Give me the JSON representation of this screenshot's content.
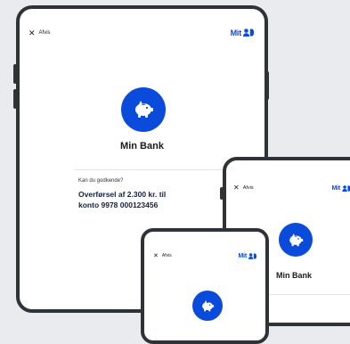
{
  "tablet": {
    "close_label": "Afvis",
    "brand": "Mit",
    "bank_name": "Min Bank",
    "question": "Kan du godkende?",
    "detail_line1": "Overførsel af 2.300 kr. til",
    "detail_line2": "konto 9978 000123456"
  },
  "phone_right": {
    "close_label": "Afvis",
    "brand": "Mit",
    "bank_name": "Min Bank"
  },
  "phone_small": {
    "close_label": "Afvis",
    "brand": "Mit"
  },
  "colors": {
    "brand_blue": "#0a4bdc",
    "device_frame": "#2f3338",
    "background": "#e9ebee"
  },
  "icons": [
    "close-icon",
    "piggy-bank-icon",
    "mitid-logo-icon"
  ]
}
